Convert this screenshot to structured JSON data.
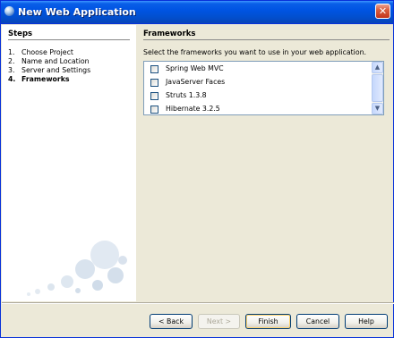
{
  "window": {
    "title": "New Web Application",
    "app_icon": "globe-icon",
    "close_glyph": "✕"
  },
  "steps": {
    "title": "Steps",
    "items": [
      {
        "num": "1.",
        "label": "Choose Project",
        "current": false
      },
      {
        "num": "2.",
        "label": "Name and Location",
        "current": false
      },
      {
        "num": "3.",
        "label": "Server and Settings",
        "current": false
      },
      {
        "num": "4.",
        "label": "Frameworks",
        "current": true
      }
    ]
  },
  "frameworks": {
    "title": "Frameworks",
    "instruction": "Select the frameworks you want to use in your web application.",
    "items": [
      {
        "label": "Spring Web MVC",
        "checked": false
      },
      {
        "label": "JavaServer Faces",
        "checked": false
      },
      {
        "label": "Struts 1.3.8",
        "checked": false
      },
      {
        "label": "Hibernate 3.2.5",
        "checked": false
      }
    ]
  },
  "buttons": {
    "back": "< Back",
    "next": "Next >",
    "finish": "Finish",
    "cancel": "Cancel",
    "help": "Help"
  },
  "colors": {
    "titlebar": "#0054e3",
    "panel_bg": "#ece9d8",
    "list_border": "#7f9db9"
  }
}
